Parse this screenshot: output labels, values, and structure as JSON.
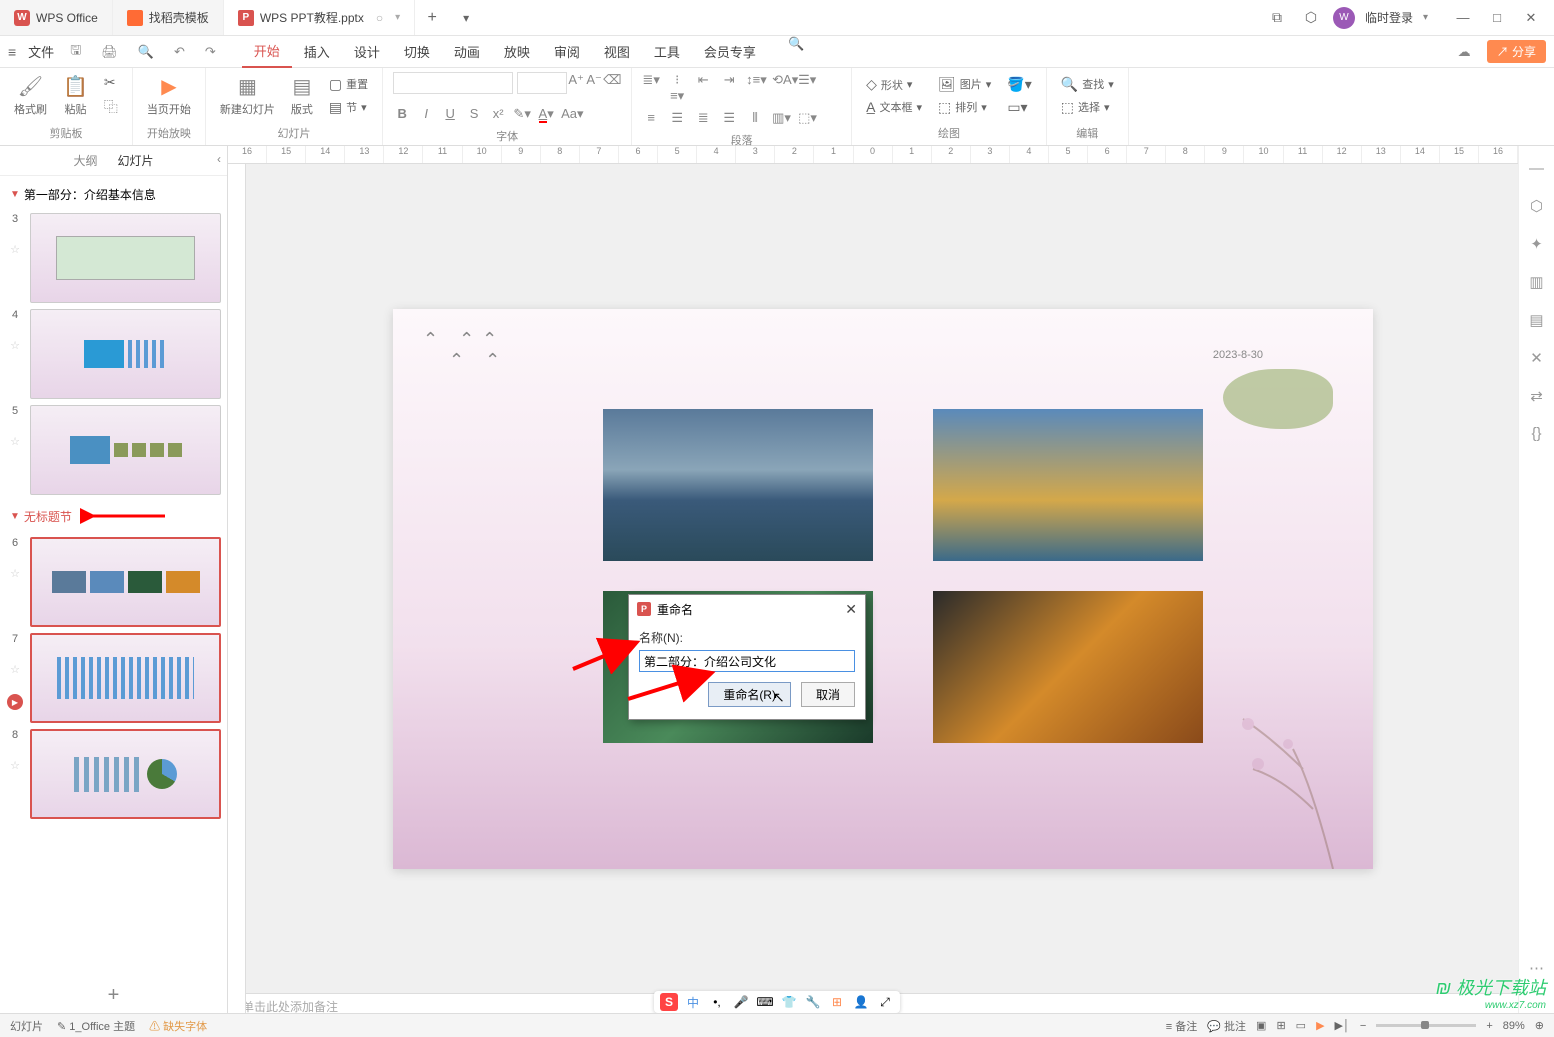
{
  "title_tabs": {
    "wps": "WPS Office",
    "template": "找稻壳模板",
    "doc": "WPS PPT教程.pptx"
  },
  "login_text": "临时登录",
  "menu": {
    "file": "文件",
    "tabs": [
      "开始",
      "插入",
      "设计",
      "切换",
      "动画",
      "放映",
      "审阅",
      "视图",
      "工具",
      "会员专享"
    ],
    "share": "分享"
  },
  "ribbon": {
    "format_painter": "格式刷",
    "paste": "粘贴",
    "clipboard": "剪贴板",
    "from_current": "当页开始",
    "start_show": "开始放映",
    "new_slide": "新建幻灯片",
    "layout": "版式",
    "reset": "重置",
    "section": "节",
    "slides": "幻灯片",
    "font": "字体",
    "paragraph": "段落",
    "shape": "形状",
    "picture": "图片",
    "textbox": "文本框",
    "arrange": "排列",
    "drawing": "绘图",
    "find": "查找",
    "select": "选择",
    "editing": "编辑"
  },
  "side_tabs": {
    "outline": "大纲",
    "slides": "幻灯片"
  },
  "sections": {
    "first": "第一部分：介绍基本信息",
    "untitled": "无标题节"
  },
  "slide_numbers": [
    "3",
    "4",
    "5",
    "6",
    "7",
    "8"
  ],
  "canvas_date": "2023-8-30",
  "dialog": {
    "title": "重命名",
    "name_label": "名称(N):",
    "input_value": "第二部分：介绍公司文化",
    "rename_btn": "重命名(R)",
    "cancel_btn": "取消"
  },
  "notes_placeholder": "单击此处添加备注",
  "status": {
    "slide_label": "幻灯片",
    "theme": "1_Office 主题",
    "missing_font": "缺失字体",
    "notes": "备注",
    "comment": "批注",
    "zoom": "89%"
  },
  "add_btn": "+",
  "watermark": {
    "brand": "极光下载站",
    "url": "www.xz7.com"
  },
  "ruler_labels": [
    "16",
    "15",
    "14",
    "13",
    "12",
    "11",
    "10",
    "9",
    "8",
    "7",
    "6",
    "5",
    "4",
    "3",
    "2",
    "1",
    "0",
    "1",
    "2",
    "3",
    "4",
    "5",
    "6",
    "7",
    "8",
    "9",
    "10",
    "11",
    "12",
    "13",
    "14",
    "15",
    "16"
  ],
  "ime_chinese": "中"
}
